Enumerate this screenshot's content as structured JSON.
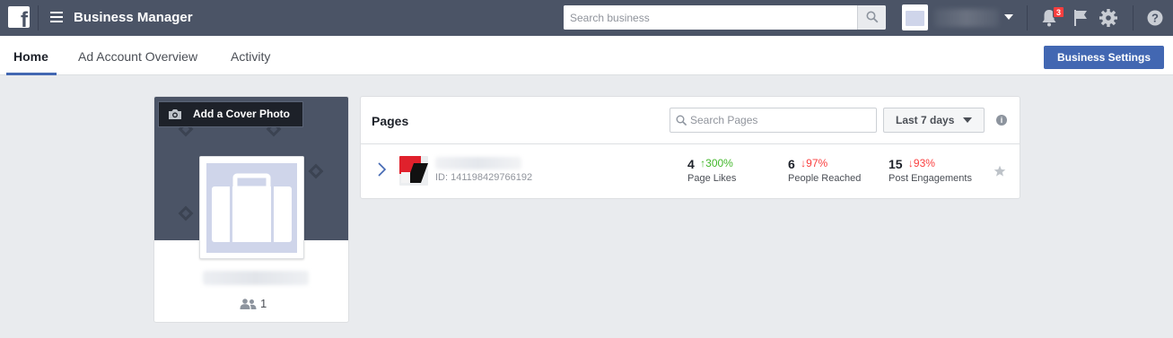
{
  "header": {
    "app_title": "Business Manager",
    "search": {
      "placeholder": "Search business",
      "value": ""
    },
    "notifications_count": "3",
    "icons": [
      "facebook-logo",
      "hamburger-menu-icon",
      "search-icon",
      "caret-down-icon",
      "bell-icon",
      "flag-icon",
      "gear-icon",
      "help-icon"
    ]
  },
  "tabs": [
    {
      "label": "Home",
      "active": true
    },
    {
      "label": "Ad Account Overview",
      "active": false
    },
    {
      "label": "Activity",
      "active": false
    }
  ],
  "business_settings_label": "Business Settings",
  "business_card": {
    "add_cover_label": "Add a Cover Photo",
    "people_count": "1"
  },
  "pages_panel": {
    "title": "Pages",
    "search_placeholder": "Search Pages",
    "range_label": "Last 7 days",
    "rows": [
      {
        "id_label": "ID: 141198429766192",
        "metrics": [
          {
            "value": "4",
            "change": "300%",
            "direction": "up",
            "label": "Page Likes"
          },
          {
            "value": "6",
            "change": "97%",
            "direction": "down",
            "label": "People Reached"
          },
          {
            "value": "15",
            "change": "93%",
            "direction": "down",
            "label": "Post Engagements"
          }
        ]
      }
    ]
  },
  "colors": {
    "topbar": "#4b5466",
    "accent": "#4267b2",
    "positive": "#42b72a",
    "negative": "#fa3e3e",
    "background": "#e9ebee"
  }
}
